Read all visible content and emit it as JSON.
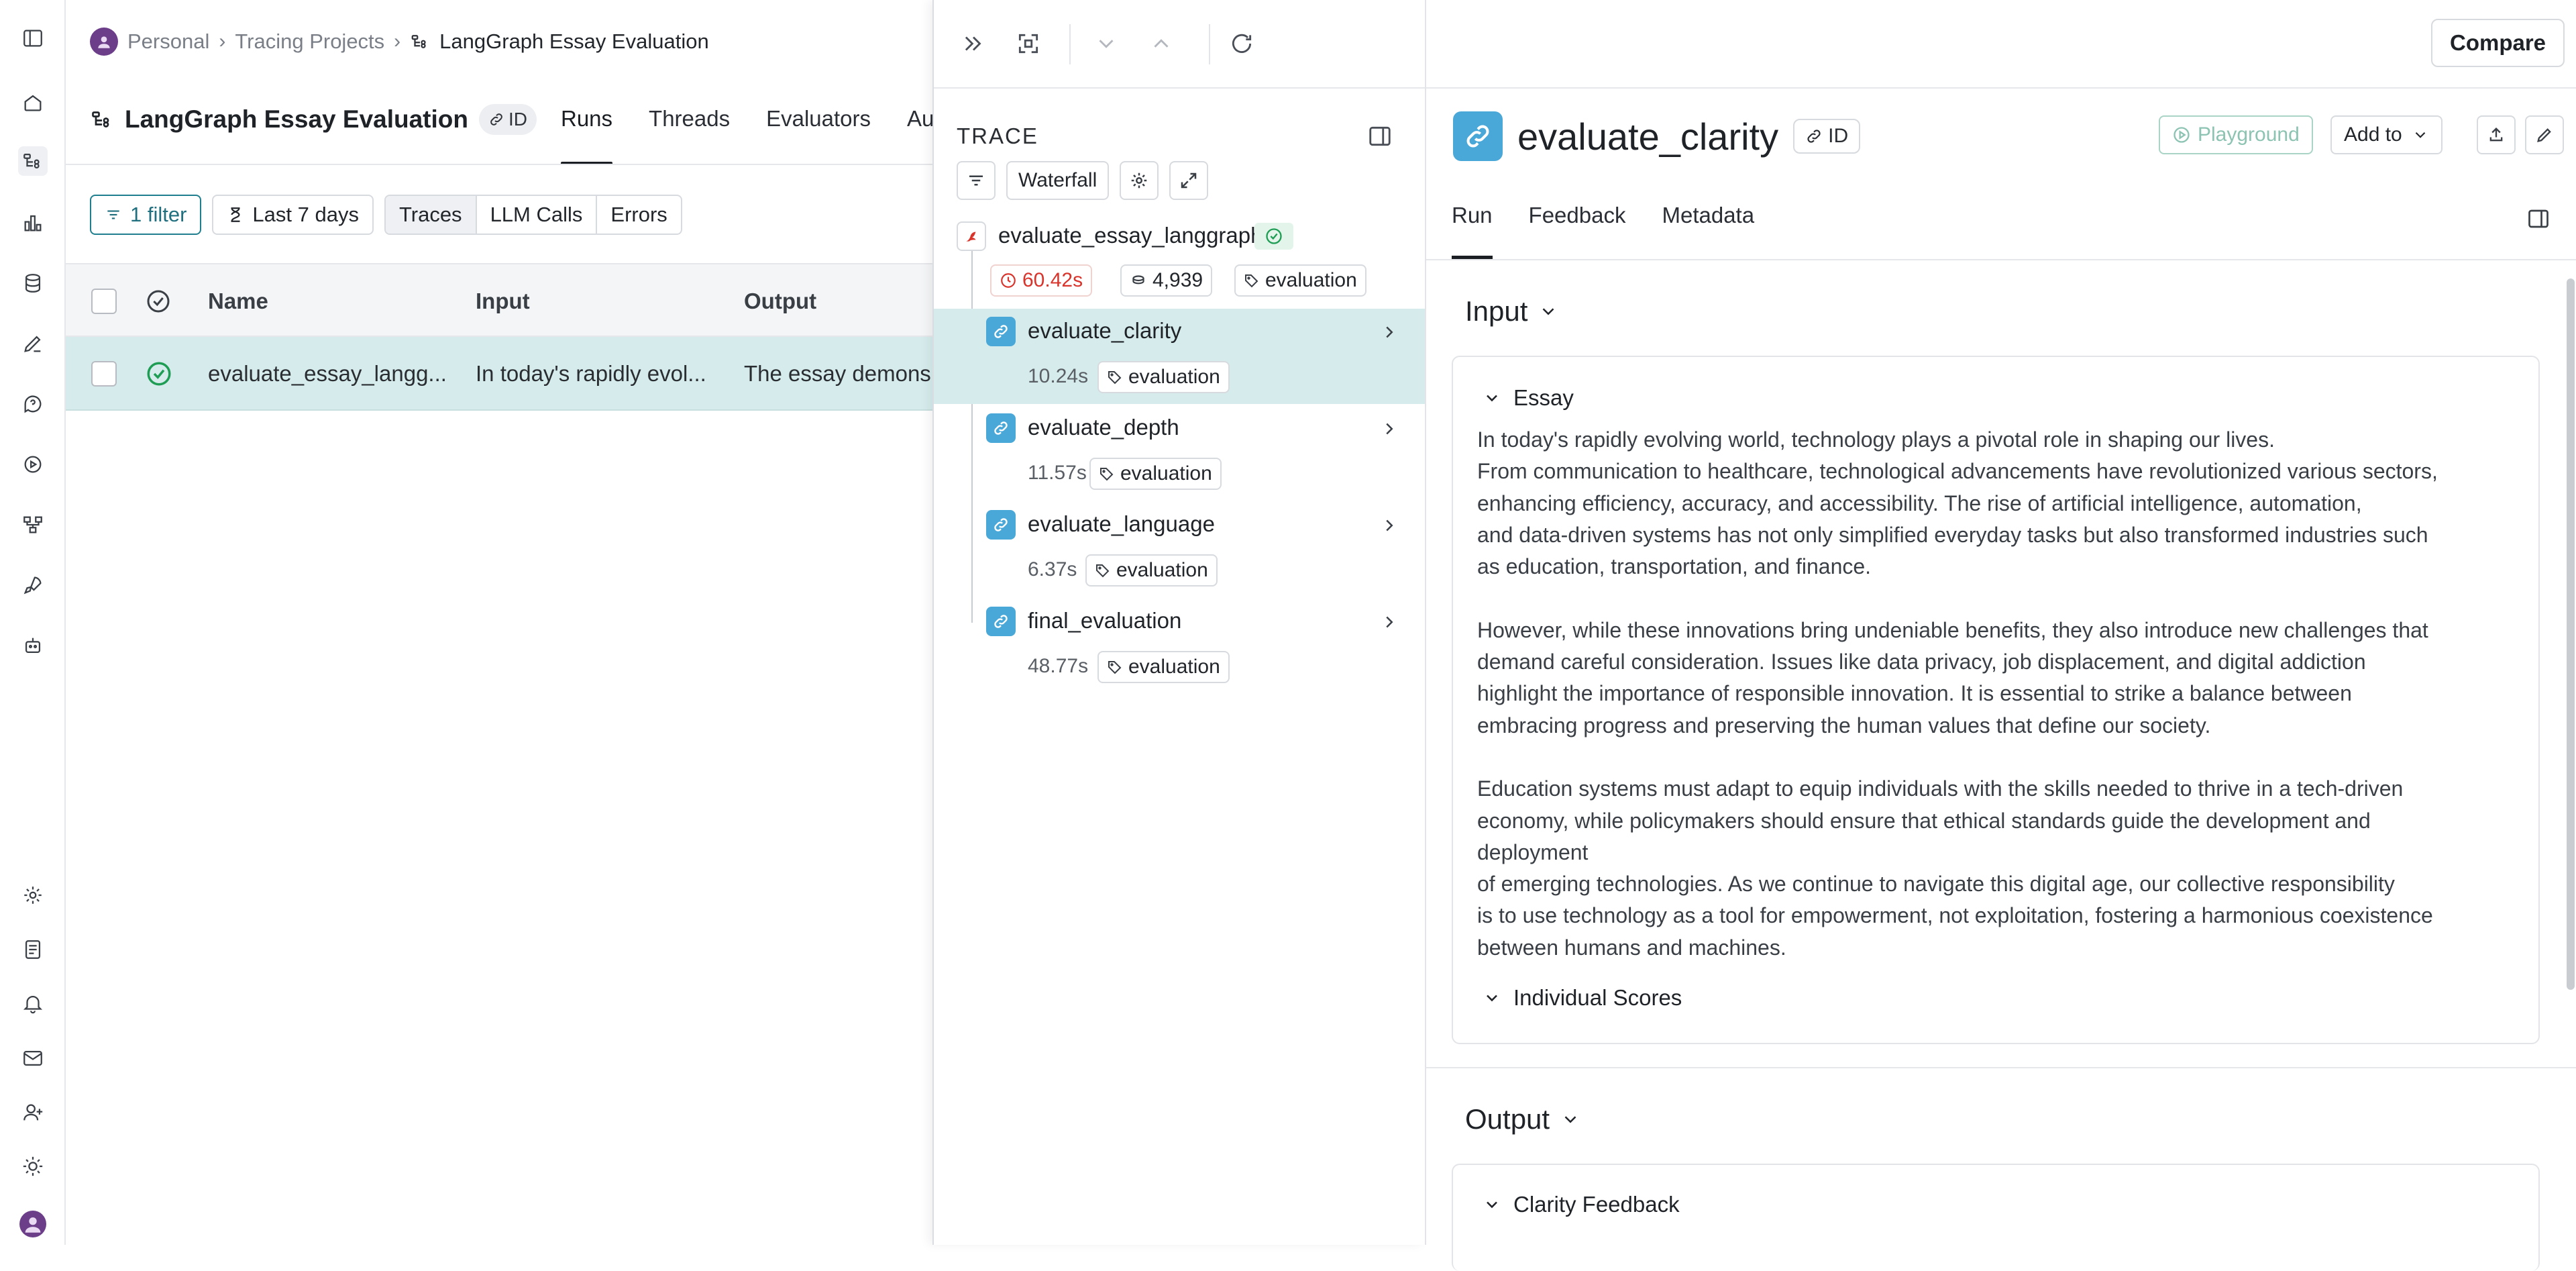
{
  "breadcrumb": {
    "workspace": "Personal",
    "section": "Tracing Projects",
    "project": "LangGraph Essay Evaluation"
  },
  "project": {
    "title": "LangGraph Essay Evaluation",
    "id_label": "ID",
    "tabs": [
      "Runs",
      "Threads",
      "Evaluators",
      "Auto"
    ]
  },
  "filters": {
    "filter_label": "1 filter",
    "time_label": "Last 7 days",
    "types": [
      "Traces",
      "LLM Calls",
      "Errors"
    ]
  },
  "table": {
    "columns": [
      "Name",
      "Input",
      "Output"
    ],
    "rows": [
      {
        "name": "evaluate_essay_langg...",
        "input": "In today's rapidly evol...",
        "output": "The essay demons"
      }
    ]
  },
  "trace": {
    "label": "TRACE",
    "view_label": "Waterfall",
    "root": {
      "name": "evaluate_essay_langgraph",
      "latency": "60.42s",
      "tokens": "4,939",
      "tag": "evaluation"
    },
    "children": [
      {
        "name": "evaluate_clarity",
        "latency": "10.24s",
        "tag": "evaluation"
      },
      {
        "name": "evaluate_depth",
        "latency": "11.57s",
        "tag": "evaluation"
      },
      {
        "name": "evaluate_language",
        "latency": "6.37s",
        "tag": "evaluation"
      },
      {
        "name": "final_evaluation",
        "latency": "48.77s",
        "tag": "evaluation"
      }
    ]
  },
  "detail": {
    "title": "evaluate_clarity",
    "id_label": "ID",
    "playground_label": "Playground",
    "add_to_label": "Add to",
    "compare_label": "Compare",
    "tabs": [
      "Run",
      "Feedback",
      "Metadata"
    ],
    "input_heading": "Input",
    "essay_heading": "Essay",
    "essay_text": "In today's rapidly evolving world, technology plays a pivotal role in shaping our lives.\nFrom communication to healthcare, technological advancements have revolutionized various sectors,\nenhancing efficiency, accuracy, and accessibility. The rise of artificial intelligence, automation,\nand data-driven systems has not only simplified everyday tasks but also transformed industries such\nas education, transportation, and finance.\n\nHowever, while these innovations bring undeniable benefits, they also introduce new challenges that\ndemand careful consideration. Issues like data privacy, job displacement, and digital addiction\nhighlight the importance of responsible innovation. It is essential to strike a balance between\nembracing progress and preserving the human values that define our society.\n\nEducation systems must adapt to equip individuals with the skills needed to thrive in a tech-driven\neconomy, while policymakers should ensure that ethical standards guide the development and\ndeployment\nof emerging technologies. As we continue to navigate this digital age, our collective responsibility\nis to use technology as a tool for empowerment, not exploitation, fostering a harmonious coexistence\nbetween humans and machines.",
    "individual_scores_heading": "Individual Scores",
    "output_heading": "Output",
    "clarity_feedback_heading": "Clarity Feedback"
  },
  "colors": {
    "selected_row": "#d6ecec",
    "run_icon": "#4aa8d8",
    "success": "#1f9d55",
    "latency_warn": "#d9342b",
    "teal": "#1f7f8f"
  },
  "icons": {
    "rail": [
      "sidebar-toggle-icon",
      "home-icon",
      "tracing-icon",
      "monitoring-icon",
      "datasets-icon",
      "annotation-icon",
      "prompts-icon",
      "deployments-icon",
      "graph-icon",
      "rocket-icon",
      "bot-icon",
      "settings-icon",
      "docs-icon",
      "notifications-icon",
      "mail-icon",
      "add-user-icon",
      "theme-icon",
      "user-avatar"
    ]
  }
}
